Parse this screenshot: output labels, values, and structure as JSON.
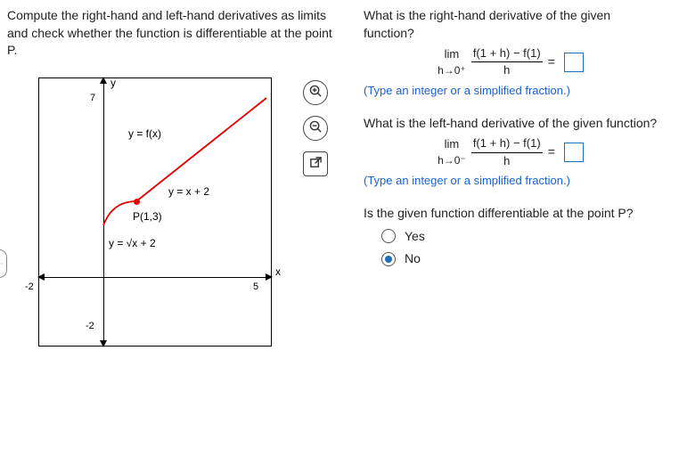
{
  "left": {
    "prompt": "Compute the right-hand and left-hand derivatives as limits and check whether the function is differentiable at the point P."
  },
  "graph": {
    "fx_label": "y = f(x)",
    "line_label": "y = x + 2",
    "sqrt_label": "y = √x + 2",
    "point_label": "P(1,3)",
    "y_axis_label": "y",
    "x_axis_label": "x",
    "tick_y_pos": "7",
    "tick_y_neg": "-2",
    "tick_x_neg": "-2",
    "tick_x_pos": "5"
  },
  "right": {
    "q1": "What is the right-hand derivative of the given function?",
    "lim_label": "lim",
    "right_approach": "h→0⁺",
    "left_approach": "h→0⁻",
    "frac_num": "f(1 + h) − f(1)",
    "frac_den": "h",
    "equals": "=",
    "note": "(Type an integer or a simplified fraction.)",
    "q2": "What is the left-hand derivative of the given function?",
    "q3": "Is the given function differentiable at the point P?",
    "option_yes": "Yes",
    "option_no": "No"
  },
  "tools": {
    "zoom_in": "zoom-in",
    "zoom_out": "zoom-out",
    "pop": "popup"
  },
  "chart_data": {
    "type": "line",
    "title": "",
    "xlabel": "x",
    "ylabel": "y",
    "xlim": [
      -2,
      5
    ],
    "ylim": [
      -2,
      7
    ],
    "grid": false,
    "series": [
      {
        "name": "y = √x + 2",
        "domain": [
          0,
          1
        ],
        "formula": "sqrt(x)+2"
      },
      {
        "name": "y = x + 2",
        "domain": [
          1,
          5
        ],
        "formula": "x+2"
      }
    ],
    "annotations": [
      {
        "text": "y = f(x)",
        "x": 1.0,
        "y": 5.5
      },
      {
        "text": "y = x + 2",
        "x": 3.0,
        "y": 4.0
      },
      {
        "text": "P(1,3)",
        "x": 1.0,
        "y": 3.0
      },
      {
        "text": "y = √x + 2",
        "x": 0.2,
        "y": 1.3
      }
    ],
    "point_P": {
      "x": 1,
      "y": 3
    }
  }
}
